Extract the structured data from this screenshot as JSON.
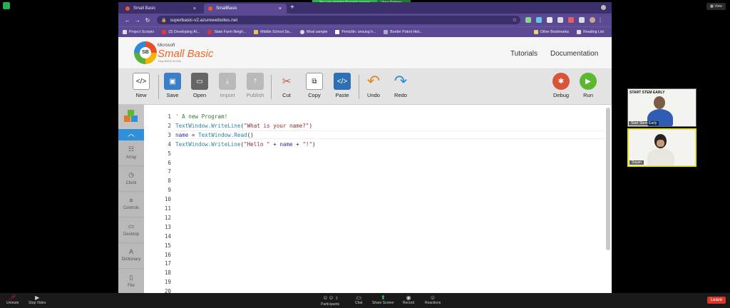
{
  "zoom": {
    "banner_message": "You are viewing Sayan's screen",
    "view_options": "View Options ⌄",
    "view_button": "View",
    "controls": {
      "unmute": "Unmute",
      "stop_video": "Stop Video",
      "participants": "Participants",
      "participant_count": "2",
      "chat": "Chat",
      "share_screen": "Share Screen",
      "record": "Record",
      "reactions": "Reactions",
      "leave": "Leave"
    },
    "participants": [
      {
        "name": "Start Stem Early",
        "poster": "START STEM EARLY"
      },
      {
        "name": "Sayan"
      }
    ]
  },
  "browser": {
    "tabs": [
      {
        "title": "Small Basic"
      },
      {
        "title": "SmallBasic"
      }
    ],
    "url": "superbasic-v2.azurewebsites.net",
    "bookmarks": [
      "Project Scorpio",
      "(3) Developing AI...",
      "State Farm Neigh...",
      "Middle School Sa...",
      "Miral sample",
      "Penicilin: unsung h...",
      "Border Patrol Hist..."
    ],
    "other_bookmarks": "Other Bookmarks",
    "reading_list": "Reading List"
  },
  "app": {
    "logo_small": "Microsoft",
    "logo_title": "Small Basic",
    "logo_sub": "Easy BASIC for Kids",
    "nav": [
      "Tutorials",
      "Documentation"
    ],
    "toolbar": {
      "new": "New",
      "save": "Save",
      "open": "Open",
      "import": "Import",
      "publish": "Publish",
      "cut": "Cut",
      "copy": "Copy",
      "paste": "Paste",
      "undo": "Undo",
      "redo": "Redo",
      "debug": "Debug",
      "run": "Run"
    },
    "sidebar": [
      "Array",
      "Clock",
      "Controls",
      "Desktop",
      "Dictionary",
      "File"
    ],
    "code_lines": [
      "' A new Program!",
      "TextWindow.WriteLine(\"What is your name?\")",
      "name = TextWindow.Read()",
      "TextWindow.WriteLine(\"Hello \" + name + \"!\")"
    ],
    "line_count": 20
  },
  "colors": {
    "browser_purple": "#5b4a93",
    "tab_strip": "#3c2f6b",
    "sb_accent": "#2f8fd8",
    "share_green": "#2bd36a",
    "leave_red": "#d9362b"
  }
}
